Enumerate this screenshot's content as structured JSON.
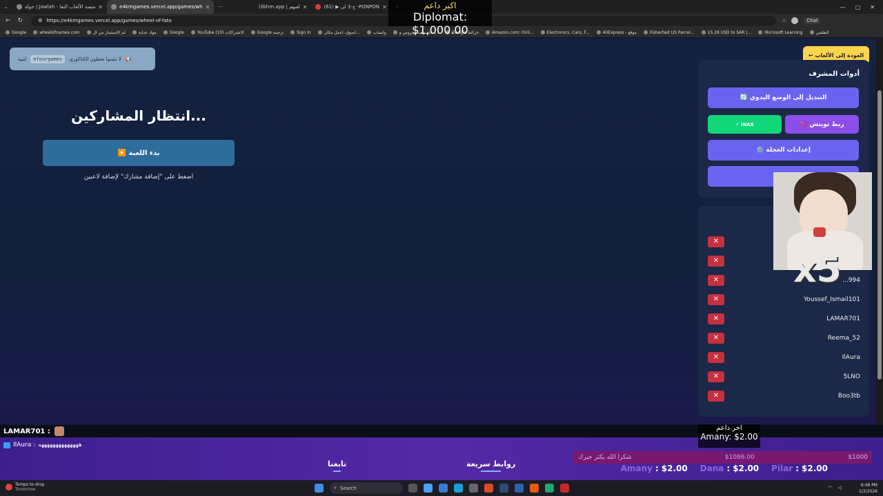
{
  "browser": {
    "tabs": [
      {
        "title": "جولة | Jawlah - منصة الألعاب التفا"
      },
      {
        "title": "e4kmgames.vercel.app/games/wh"
      },
      {
        "title": "···"
      },
      {
        "title": "l3bhm.app | لعبهم"
      },
      {
        "title": "(61) ▶ ج-3 لي -PONPON"
      }
    ],
    "url": "https://e4kmgames.vercel.app/games/wheel-of-fate",
    "bookmarks": [
      "Google",
      "wheelofnames.com",
      "لم الاستثمار من ال",
      "مواد عداية",
      "Google",
      "YouTube (10) الاشتراكات",
      "Google ترجمة",
      "Sign In",
      "اسوق، اعمل مكان...",
      "واتساب",
      "محاضرات وجروس و...",
      "Google خرائط",
      "Amazon.com: Onli...",
      "Electronics, Cars, F...",
      "AliExpress - موقع",
      "Fisherfast US Parcel...",
      "15.28 USD to SAR |...",
      "Microsoft Learning",
      "الطقس"
    ],
    "chat_label": "Chat"
  },
  "overlay_top": {
    "label": "اكبر داعم",
    "value": "Diplomat: $1,000.00"
  },
  "notice": {
    "text": "لا تنسوا تحطون الكتاكوري",
    "code": "efourgames",
    "suffix": "لتبية"
  },
  "main": {
    "waiting": "انتظار المشاركين...",
    "start_label": "▶️ بدء اللعبة",
    "hint": "اضغط على \"إضافة مشارك\" لإضافة لاعبين"
  },
  "back_label": "↩ العودة إلى الألعاب",
  "admin": {
    "title": "أدوات المشرف",
    "manual": "🔄 التبديل إلى الوضع اليدوي",
    "twitch": "🟣 ربط تويتش",
    "inas": "⚡ INAS",
    "wheel": "⚙️ إعدادات العجلة",
    "third": "♻️ ..."
  },
  "participants": [
    "",
    "",
    "...994",
    "Youssef_Ismail101",
    "LAMAR701",
    "Reema_52",
    "IlAura",
    "5LNO",
    "Boo3tb"
  ],
  "webcam_text": "x5",
  "chat": {
    "line1_user": "LAMAR701 :",
    "line2_user": "IlAura :",
    "line2_msg": "ههههههههههههههه"
  },
  "bottom_nav": {
    "follow": "تابعنا",
    "links": "روابط سريعة"
  },
  "last_donor": {
    "label": "اخر داعم",
    "value": "Amany: $2.00"
  },
  "ticker": {
    "left": "شكرا الله يكثر خيرك",
    "mid": "$1086.00",
    "right": "$1000"
  },
  "donations": [
    {
      "name": "Amany",
      "amount": "$2.00"
    },
    {
      "name": "Dana",
      "amount": "$2.00"
    },
    {
      "name": "Pilar",
      "amount": "$2.00"
    }
  ],
  "taskbar": {
    "weather_title": "Temps to drop",
    "weather_sub": "Tomorrow",
    "search": "Search",
    "time": "6:48 PM",
    "date": "1/3/2026"
  }
}
